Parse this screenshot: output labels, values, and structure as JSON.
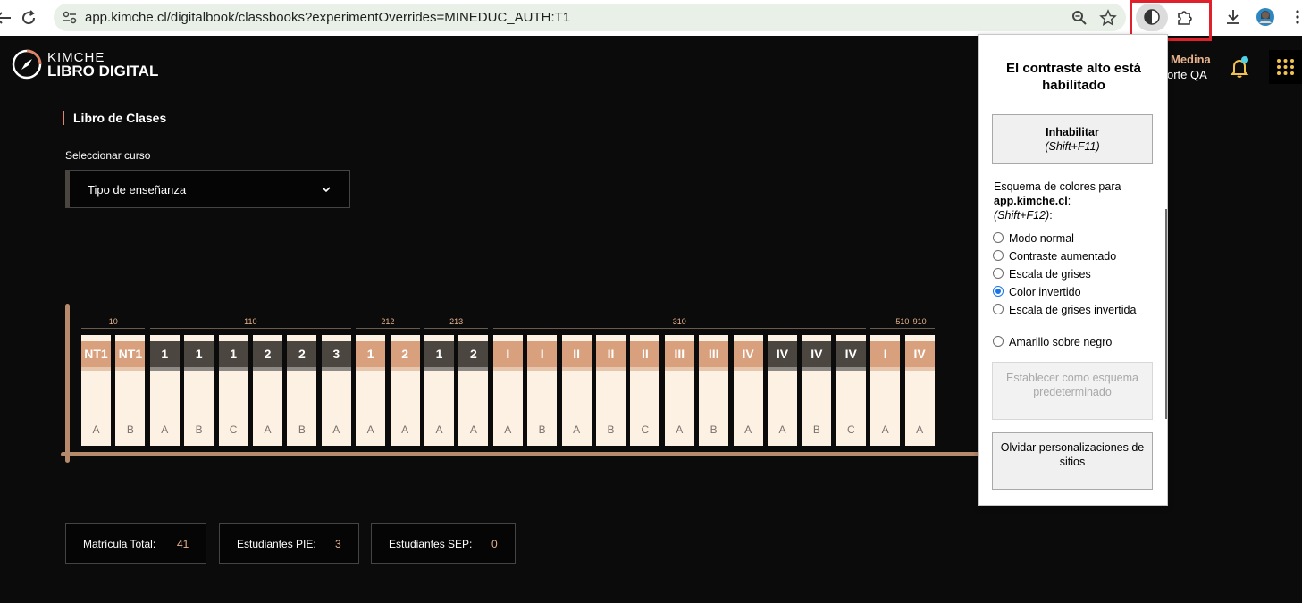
{
  "browser": {
    "url": "app.kimche.cl/digitalbook/classbooks?experimentOverrides=MINEDUC_AUTH:T1",
    "icons": [
      "back-icon",
      "reload-icon",
      "site-settings-icon",
      "zoom-icon",
      "bookmark-star-icon",
      "contrast-extension-icon",
      "extensions-puzzle-icon",
      "download-icon",
      "profile-avatar",
      "browser-menu-icon"
    ]
  },
  "app": {
    "logo_line1": "KIMCHE",
    "logo_line2": "LIBRO DIGITAL",
    "user_name": "Medina",
    "user_role": "orte QA",
    "accent_color": "#e8b38c"
  },
  "page": {
    "section_title": "Libro de Clases",
    "select_label": "Seleccionar curso",
    "select_value": "Tipo de enseñanza"
  },
  "groups": [
    {
      "label": "10",
      "start": 0,
      "end": 1
    },
    {
      "label": "110",
      "start": 2,
      "end": 7
    },
    {
      "label": "212",
      "start": 8,
      "end": 9
    },
    {
      "label": "213",
      "start": 10,
      "end": 11
    },
    {
      "label": "310",
      "start": 12,
      "end": 22
    },
    {
      "label": "510",
      "start": 23,
      "end": 25
    },
    {
      "label": "910",
      "start": 26,
      "end": 27
    }
  ],
  "books": [
    {
      "level": "NT1",
      "letter": "A",
      "tone": "tan"
    },
    {
      "level": "NT1",
      "letter": "B",
      "tone": "tan"
    },
    {
      "level": "1",
      "letter": "A",
      "tone": "dark"
    },
    {
      "level": "1",
      "letter": "B",
      "tone": "dark"
    },
    {
      "level": "1",
      "letter": "C",
      "tone": "dark"
    },
    {
      "level": "2",
      "letter": "A",
      "tone": "dark"
    },
    {
      "level": "2",
      "letter": "B",
      "tone": "dark"
    },
    {
      "level": "3",
      "letter": "A",
      "tone": "dark"
    },
    {
      "level": "1",
      "letter": "A",
      "tone": "tan"
    },
    {
      "level": "2",
      "letter": "A",
      "tone": "tan"
    },
    {
      "level": "1",
      "letter": "A",
      "tone": "dark"
    },
    {
      "level": "2",
      "letter": "A",
      "tone": "dark"
    },
    {
      "level": "I",
      "letter": "A",
      "tone": "tan"
    },
    {
      "level": "I",
      "letter": "B",
      "tone": "tan"
    },
    {
      "level": "II",
      "letter": "A",
      "tone": "tan"
    },
    {
      "level": "II",
      "letter": "B",
      "tone": "tan"
    },
    {
      "level": "II",
      "letter": "C",
      "tone": "tan"
    },
    {
      "level": "III",
      "letter": "A",
      "tone": "tan"
    },
    {
      "level": "III",
      "letter": "B",
      "tone": "tan"
    },
    {
      "level": "IV",
      "letter": "A",
      "tone": "tan"
    },
    {
      "level": "IV",
      "letter": "A",
      "tone": "dark"
    },
    {
      "level": "IV",
      "letter": "B",
      "tone": "dark"
    },
    {
      "level": "IV",
      "letter": "C",
      "tone": "dark"
    },
    {
      "level": "I",
      "letter": "A",
      "tone": "tan"
    },
    {
      "level": "IV",
      "letter": "A",
      "tone": "tan"
    }
  ],
  "stats": {
    "total_label": "Matrícula Total:",
    "total_value": "41",
    "pie_label": "Estudiantes PIE:",
    "pie_value": "3",
    "sep_label": "Estudiantes SEP:",
    "sep_value": "0"
  },
  "popup": {
    "title": "El contraste alto está habilitado",
    "disable_label": "Inhabilitar",
    "disable_shortcut": "(Shift+F11)",
    "scheme_prefix": "Esquema de colores para",
    "scheme_site": "app.kimche.cl",
    "scheme_colon": ":",
    "scheme_shortcut": "(Shift+F12)",
    "scheme_suffix": ":",
    "options": [
      {
        "label": "Modo normal",
        "checked": false
      },
      {
        "label": "Contraste aumentado",
        "checked": false
      },
      {
        "label": "Escala de grises",
        "checked": false
      },
      {
        "label": "Color invertido",
        "checked": true
      },
      {
        "label": "Escala de grises invertida",
        "checked": false
      },
      {
        "label": "Amarillo sobre negro",
        "checked": false
      }
    ],
    "set_default_label": "Establecer como esquema predeterminado",
    "forget_label": "Olvidar personalizaciones de sitios"
  }
}
